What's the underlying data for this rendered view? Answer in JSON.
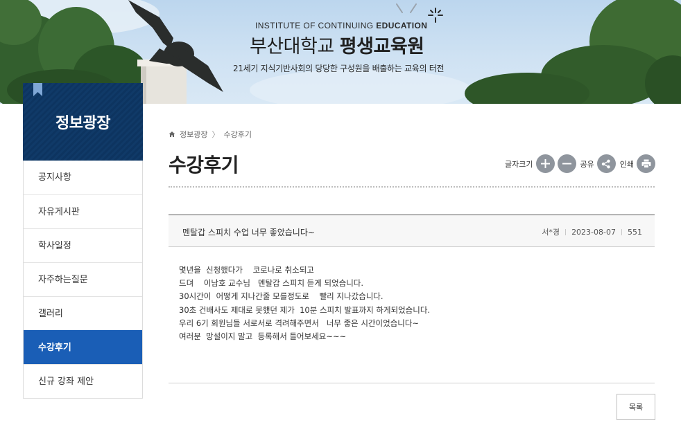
{
  "banner": {
    "subtitle_prefix": "INSTITUTE OF CONTINUING ",
    "subtitle_bold": "EDUCATION",
    "title_regular": "부산대학교 ",
    "title_bold": "평생교육원",
    "slogan": "21세기 지식기반사회의 당당한 구성원을 배출하는 교육의 터전"
  },
  "sidebar": {
    "title": "정보광장",
    "items": [
      {
        "label": "공지사항"
      },
      {
        "label": "자유게시판"
      },
      {
        "label": "학사일정"
      },
      {
        "label": "자주하는질문"
      },
      {
        "label": "갤러리"
      },
      {
        "label": "수강후기",
        "active": true
      },
      {
        "label": "신규 강좌 제안"
      }
    ]
  },
  "breadcrumb": {
    "items": [
      "정보광장",
      "수강후기"
    ],
    "separator": "〉"
  },
  "page": {
    "title": "수강후기"
  },
  "tools": {
    "font_size_label": "글자크기",
    "share_label": "공유",
    "print_label": "인쇄"
  },
  "post": {
    "title": "멘탈갑 스피치 수업 너무 좋았습니다~",
    "author": "서*경",
    "date": "2023-08-07",
    "views": "551",
    "body": "몇년을  신청했다가    코로나로 취소되고\n드뎌    이남호 교수님   멘탈갑 스피치 듣게 되었습니다.\n30시간이  어떻게 지나간줄 모를정도로    빨리 지나갔습니다.\n30초 건배사도 제대로 못했던 제가  10분 스피치 발표까지 하게되었습니다.\n우리 6기 회원님들 서로서로 격려해주면서   너무 좋은 시간이었습니다~\n여러분  망설이지 말고  등록해서 들어보세요~~~"
  },
  "buttons": {
    "list_label": "목록"
  },
  "colors": {
    "sidebar_head": "#103a68",
    "active_menu": "#1a5eb6",
    "tool_button": "#8f959d"
  }
}
